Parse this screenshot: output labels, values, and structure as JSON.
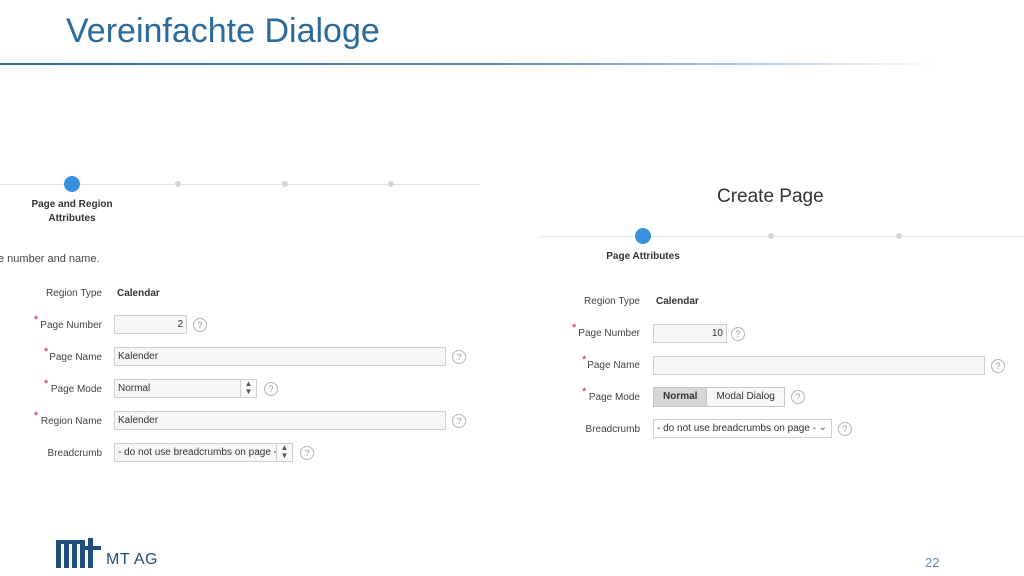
{
  "slide": {
    "title": "Vereinfachte Dialoge",
    "page_number": "22",
    "logo_text": "MT AG"
  },
  "left_dialog": {
    "steps": [
      {
        "label": "Page and Region Attributes",
        "active": true
      },
      {
        "label": "",
        "active": false
      },
      {
        "label": "",
        "active": false
      },
      {
        "label": "",
        "active": false
      }
    ],
    "intro": "e number and name.",
    "fields": {
      "region_type": {
        "label": "Region Type",
        "value": "Calendar"
      },
      "page_number": {
        "label": "Page Number",
        "value": "2",
        "required": "*"
      },
      "page_name": {
        "label": "Page Name",
        "value": "Kalender",
        "required": "*"
      },
      "page_mode": {
        "label": "Page Mode",
        "value": "Normal",
        "required": "*"
      },
      "region_name": {
        "label": "Region Name",
        "value": "Kalender",
        "required": "*"
      },
      "breadcrumb": {
        "label": "Breadcrumb",
        "value": "- do not use breadcrumbs on page -"
      }
    },
    "help_glyph": "?"
  },
  "right_dialog": {
    "title": "Create Page",
    "steps": [
      {
        "label": "Page Attributes",
        "active": true
      },
      {
        "label": "",
        "active": false
      },
      {
        "label": "",
        "active": false
      }
    ],
    "fields": {
      "region_type": {
        "label": "Region Type",
        "value": "Calendar"
      },
      "page_number": {
        "label": "Page Number",
        "value": "10",
        "required": "*"
      },
      "page_name": {
        "label": "Page Name",
        "value": "",
        "required": "*"
      },
      "page_mode": {
        "label": "Page Mode",
        "required": "*",
        "options": [
          "Normal",
          "Modal Dialog"
        ],
        "selected": "Normal"
      },
      "breadcrumb": {
        "label": "Breadcrumb",
        "value": "- do not use breadcrumbs on page -"
      }
    },
    "help_glyph": "?"
  },
  "colors": {
    "title_blue": "#2b6a9c",
    "step_active": "#3b8fe0",
    "required_red": "#c8102e"
  },
  "icons": {
    "help": "help-circle-icon",
    "select_arrows": "up-down-arrows-icon",
    "chevron": "chevron-down-icon"
  }
}
